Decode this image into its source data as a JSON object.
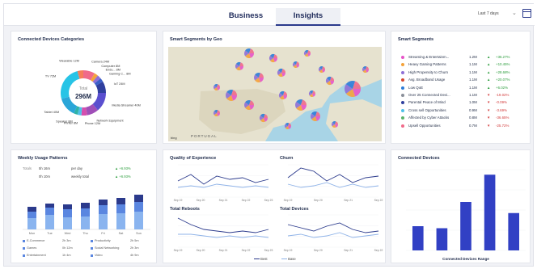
{
  "tabs": [
    {
      "label": "Business"
    },
    {
      "label": "Insights"
    }
  ],
  "date_range": "Last 7 days",
  "colors": {
    "accent": "#2b3a8c",
    "bar": "#3140c4",
    "pos": "#2e9e3f",
    "neg": "#d23b3b"
  },
  "devices": {
    "title": "Connected Devices Categories",
    "center_label": "Total",
    "total": "296M",
    "slices": [
      {
        "label": "Camera 24M",
        "value": 24,
        "color": "#f06a8a"
      },
      {
        "label": "Computer 8M",
        "value": 8,
        "color": "#f4a23a"
      },
      {
        "label": "Endu... 8M",
        "value": 8,
        "color": "#8e6fd6"
      },
      {
        "label": "Gaming C... 8M",
        "value": 8,
        "color": "#3a5fc8"
      },
      {
        "label": "IoT 24M",
        "value": 24,
        "color": "#2f3f9e"
      },
      {
        "label": "Media Streamer 40M",
        "value": 40,
        "color": "#5a4fcf"
      },
      {
        "label": "Network Equipment",
        "value": 24,
        "color": "#a04fb8"
      },
      {
        "label": "Phone 12M",
        "value": 12,
        "color": "#d44fae"
      },
      {
        "label": "Printer 8M",
        "value": 8,
        "color": "#4fc0e8"
      },
      {
        "label": "Speaker 8M",
        "value": 8,
        "color": "#2fb3a8"
      },
      {
        "label": "Tablet 40M",
        "value": 40,
        "color": "#2aa6d8"
      },
      {
        "label": "TV 72M",
        "value": 72,
        "color": "#27c4e6"
      },
      {
        "label": "Wearable 12M",
        "value": 12,
        "color": "#f57e5a"
      }
    ]
  },
  "map": {
    "title": "Smart Segments by Geo",
    "country": "PORTUGAL",
    "brand": "bing"
  },
  "segments": {
    "title": "Smart Segments",
    "rows": [
      {
        "name": "Streaming & Entertainm...",
        "value": "1.2M",
        "change": "+36.27%",
        "dir": "up",
        "color": "#e754c8"
      },
      {
        "name": "Heavy Gaming Patterns",
        "value": "1.1M",
        "change": "+10.45%",
        "dir": "up",
        "color": "#f4a23a"
      },
      {
        "name": "High Propensity to Churn",
        "value": "1.1M",
        "change": "+28.68%",
        "dir": "up",
        "color": "#8e6fd6"
      },
      {
        "name": "Avg. Broadband Usage",
        "value": "1.1M",
        "change": "+20.07%",
        "dir": "up",
        "color": "#d4462f"
      },
      {
        "name": "Low QoE",
        "value": "1.1M",
        "change": "+6.02%",
        "dir": "up",
        "color": "#2a7bd8"
      },
      {
        "name": "Over 25 Connected Devi...",
        "value": "1.1M",
        "change": "-19.02%",
        "dir": "down",
        "color": "#8a8f99"
      },
      {
        "name": "Parental Peace of Mind",
        "value": "1.0M",
        "change": "-0.09%",
        "dir": "down",
        "color": "#2f3f9e"
      },
      {
        "name": "Cross sell Opportunities",
        "value": "0.9M",
        "change": "-3.69%",
        "dir": "down",
        "color": "#4fc0e8"
      },
      {
        "name": "Affected by Cyber Attacks",
        "value": "0.8M",
        "change": "-36.65%",
        "dir": "down",
        "color": "#5ab26a"
      },
      {
        "name": "Upsell Opportunities",
        "value": "0.7M",
        "change": "-25.72%",
        "dir": "down",
        "color": "#f06a8a"
      }
    ]
  },
  "weekly": {
    "title": "Weekly Usage Patterns",
    "stats": [
      {
        "label": "Totals",
        "value": "5h 16m",
        "per": "per day",
        "change": "+6.93%"
      },
      {
        "label": "",
        "value": "0h 10m",
        "per": "weekly total",
        "change": "+6.93%"
      }
    ],
    "days": [
      "Mon",
      "Tue",
      "Wed",
      "Thu",
      "Fri",
      "Sat",
      "Sun"
    ],
    "legend": [
      {
        "name": "E-Commerce",
        "value": "2h 3m"
      },
      {
        "name": "Productivity",
        "value": "2h 5m"
      },
      {
        "name": "Games",
        "value": "0h 12m"
      },
      {
        "name": "Social Networking",
        "value": "2h 3m"
      },
      {
        "name": "Entertainment",
        "value": "1h 4m"
      },
      {
        "name": "Video",
        "value": "4h 9m"
      }
    ]
  },
  "qoe": {
    "title": "Quality of Experience",
    "xt": [
      "Sep 19",
      "Sep 20",
      "Sep 21",
      "Sep 22",
      "Sep 23"
    ]
  },
  "churn": {
    "title": "Churn",
    "xt": [
      "Sep 19",
      "Sep 20",
      "Sep 21",
      "Sep 22"
    ]
  },
  "reboots": {
    "title": "Total Reboots",
    "xt": [
      "Sep 19",
      "Sep 20",
      "Sep 21",
      "Sep 22",
      "Sep 23"
    ]
  },
  "total_devices": {
    "title": "Total Devices",
    "xt": [
      "Sep 19",
      "Sep 20",
      "Sep 21",
      "Sep 22"
    ]
  },
  "line_legend": [
    {
      "name": "Best"
    },
    {
      "name": "Base"
    }
  ],
  "chart_data": {
    "type": "bar",
    "title": "Connected Devices",
    "xlabel": "Connected Devices Range",
    "ylabel": "",
    "values": [
      24,
      22,
      48,
      75,
      37
    ],
    "ylim": [
      0,
      80
    ],
    "grid": true
  }
}
